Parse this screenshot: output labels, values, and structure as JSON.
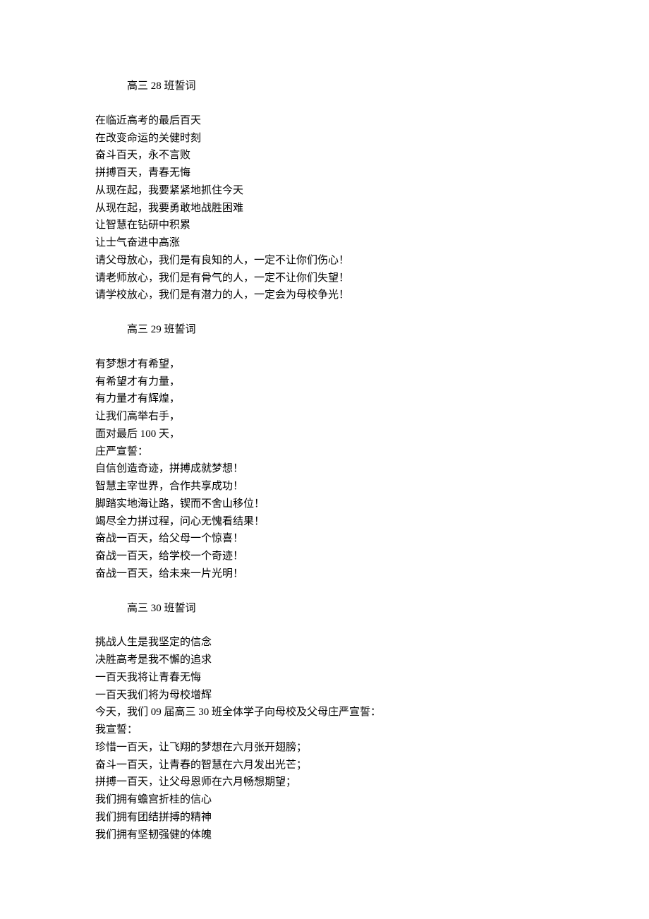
{
  "sections": [
    {
      "title": "高三 28 班誓词",
      "lines": [
        "在临近高考的最后百天",
        "在改变命运的关健时刻",
        "奋斗百天，永不言败",
        "拼搏百天，青春无悔",
        "从现在起，我要紧紧地抓住今天",
        "从现在起，我要勇敢地战胜困难",
        "让智慧在钻研中积累",
        "让士气奋进中高涨",
        "请父母放心，我们是有良知的人，一定不让你们伤心！",
        "请老师放心，我们是有骨气的人，一定不让你们失望！",
        "请学校放心，我们是有潜力的人，一定会为母校争光！"
      ]
    },
    {
      "title": "高三 29 班誓词",
      "lines": [
        "有梦想才有希望，",
        "有希望才有力量，",
        "有力量才有辉煌，",
        "让我们高举右手，",
        "面对最后 100 天，",
        "庄严宣誓：",
        "自信创造奇迹，拼搏成就梦想！",
        "智慧主宰世界，合作共享成功！",
        "脚踏实地海让路，锲而不舍山移位！",
        "竭尽全力拼过程，问心无愧看结果！",
        "奋战一百天，给父母一个惊喜！",
        "奋战一百天，给学校一个奇迹！",
        "奋战一百天，给未来一片光明！"
      ]
    },
    {
      "title": "高三 30 班誓词",
      "lines": [
        "挑战人生是我坚定的信念",
        "决胜高考是我不懈的追求",
        "一百天我将让青春无悔",
        "一百天我们将为母校增辉",
        "今天，我们 09 届高三 30 班全体学子向母校及父母庄严宣誓：",
        "我宣誓：",
        "珍惜一百天，让飞翔的梦想在六月张开翅膀；",
        "奋斗一百天，让青春的智慧在六月发出光芒；",
        "拼搏一百天，让父母恩师在六月畅想期望；",
        "我们拥有蟾宫折桂的信心",
        "我们拥有团结拼搏的精神",
        "我们拥有坚韧强健的体魄"
      ]
    }
  ]
}
